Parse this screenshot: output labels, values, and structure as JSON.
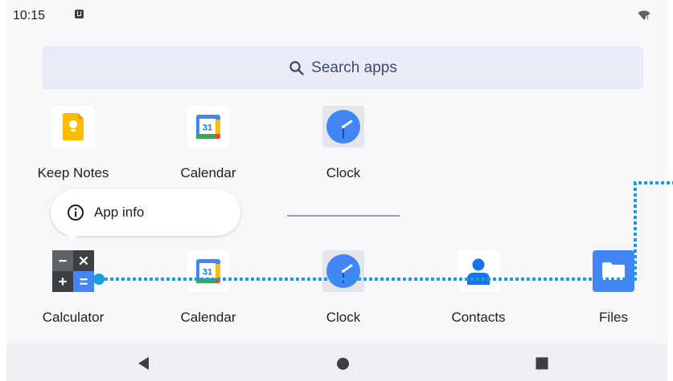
{
  "status_bar": {
    "time": "10:15",
    "notification_icon": "storage-notification-icon",
    "wifi_icon": "wifi-icon"
  },
  "search": {
    "label": "Search apps",
    "icon": "search-icon"
  },
  "top_row": [
    {
      "label": "Keep Notes",
      "icon": "keep-notes-icon"
    },
    {
      "label": "Calendar",
      "icon": "calendar-icon",
      "icon_text": "31"
    },
    {
      "label": "Clock",
      "icon": "clock-icon"
    }
  ],
  "context_menu": {
    "label": "App info",
    "icon": "info-icon"
  },
  "bottom_row": [
    {
      "label": "Calculator",
      "icon": "calculator-icon"
    },
    {
      "label": "Calendar",
      "icon": "calendar-icon",
      "icon_text": "31"
    },
    {
      "label": "Clock",
      "icon": "clock-icon"
    },
    {
      "label": "Contacts",
      "icon": "contacts-icon"
    },
    {
      "label": "Files",
      "icon": "files-icon"
    }
  ],
  "nav": {
    "back": "back-icon",
    "home": "home-icon",
    "recents": "recents-icon"
  },
  "colors": {
    "gesture": "#1b9de2",
    "screen_bg": "#f7f7fa",
    "search_bg": "#e9ecf8",
    "nav_bg": "#efeff3"
  }
}
